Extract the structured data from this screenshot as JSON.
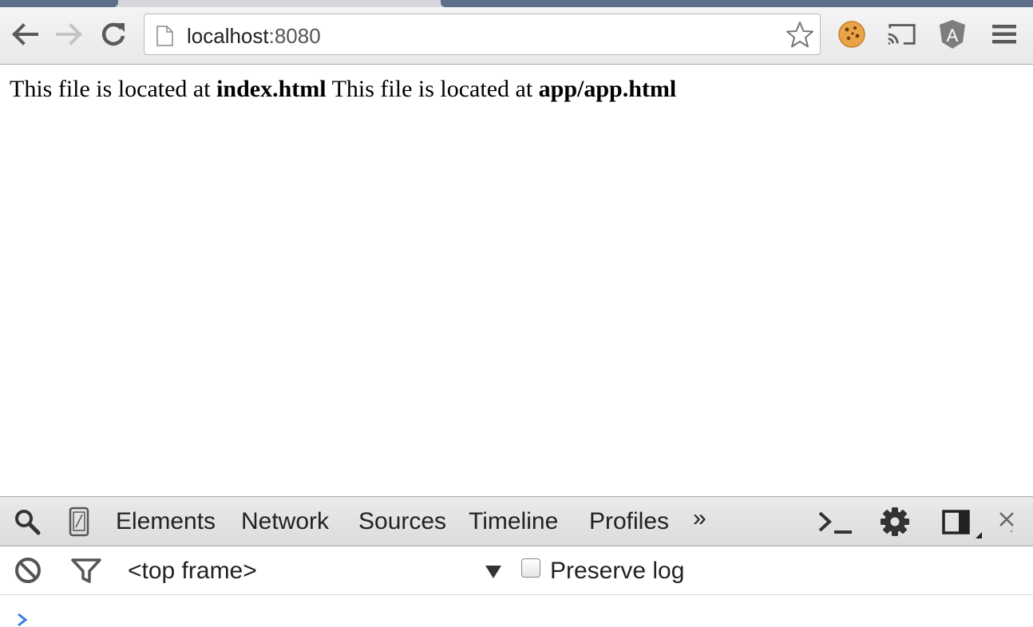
{
  "browser": {
    "url_host": "localhost",
    "url_port": ":8080"
  },
  "page": {
    "segments": [
      {
        "text": "This file is located at ",
        "bold": false
      },
      {
        "text": "index.html",
        "bold": true
      },
      {
        "text": " This file is located at ",
        "bold": false
      },
      {
        "text": "app/app.html",
        "bold": true
      }
    ]
  },
  "devtools": {
    "tabs": [
      "Elements",
      "Network",
      "Sources",
      "Timeline",
      "Profiles"
    ],
    "more_tabs": "»",
    "frame_selector": "<top frame>",
    "preserve_log_label": "Preserve log",
    "preserve_log_checked": false,
    "prompt_symbol": "›"
  },
  "colors": {
    "tab_accent": "#5c6e88",
    "prompt_blue": "#3a7ee5"
  }
}
